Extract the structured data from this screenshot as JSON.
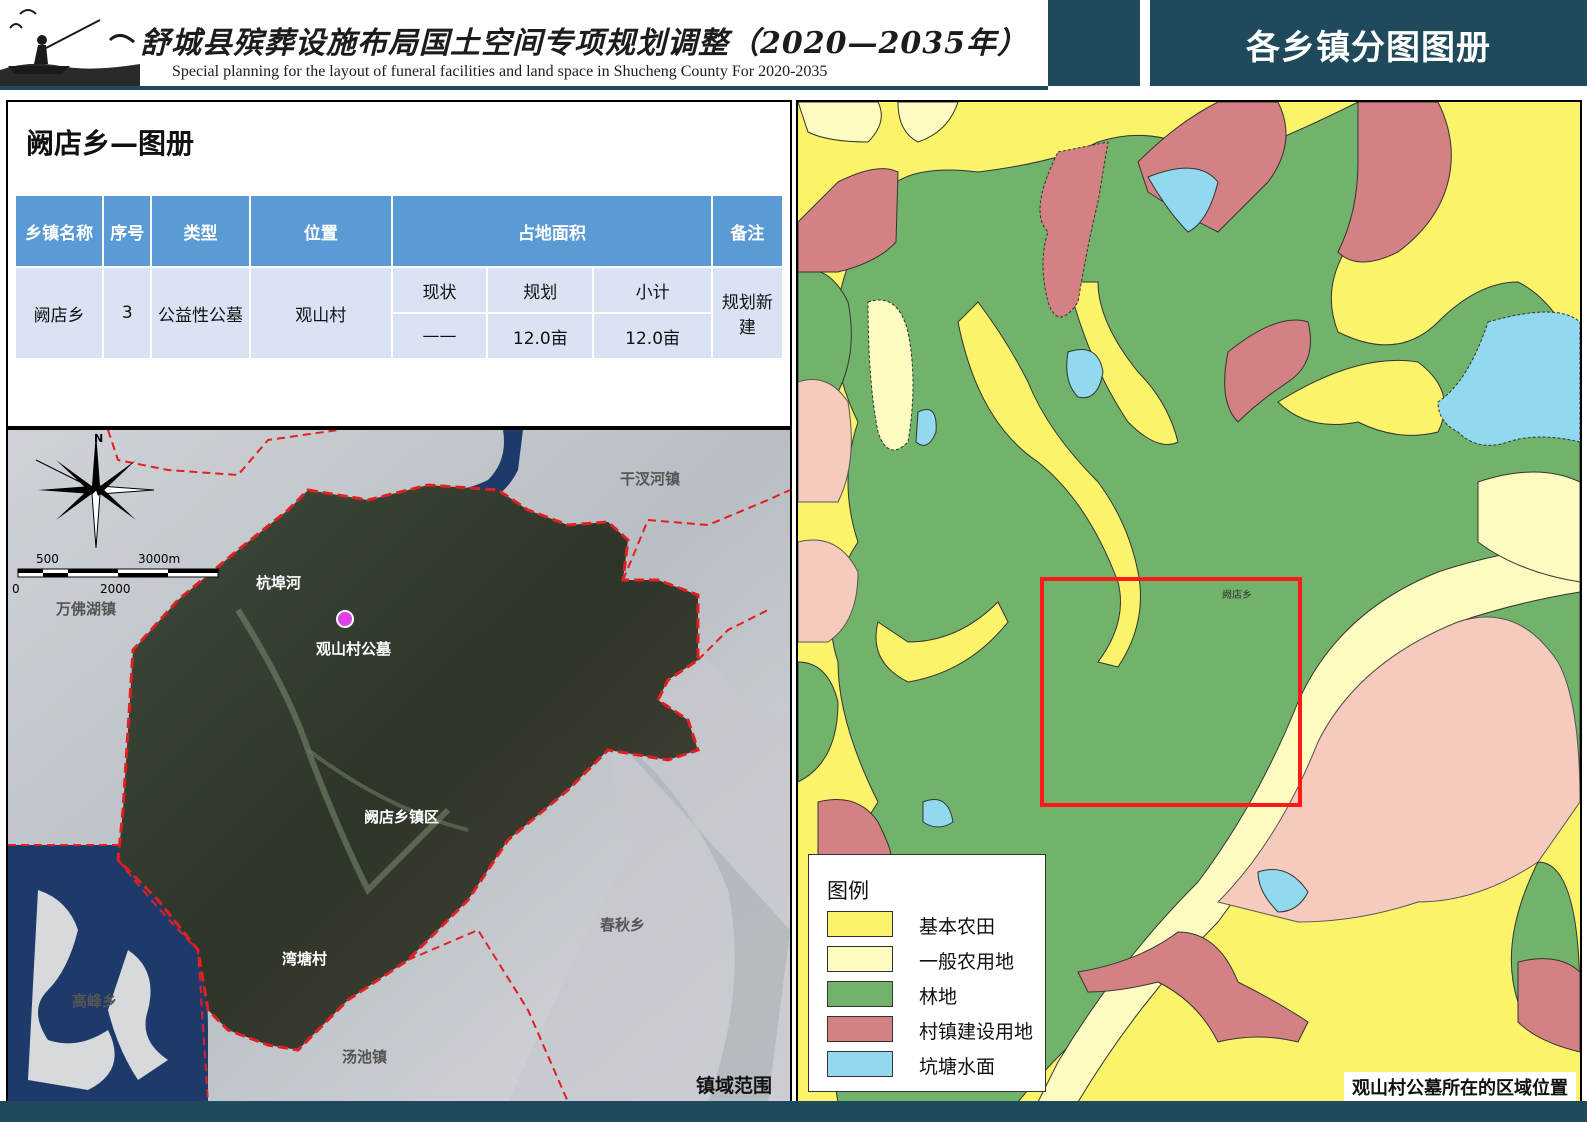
{
  "header": {
    "title_cn": "舒城县殡葬设施布局国土空间专项规划调整（2020—2035年）",
    "title_en": "Special planning for the layout of funeral facilities and land space in Shucheng County For 2020-2035",
    "section_title": "各乡镇分图图册"
  },
  "info_panel": {
    "title": "阙店乡—图册",
    "columns": {
      "township": "乡镇名称",
      "seq": "序号",
      "type": "类型",
      "location": "位置",
      "area": "占地面积",
      "note": "备注",
      "area_sub": [
        "现状",
        "规划",
        "小计"
      ]
    },
    "row": {
      "township": "阙店乡",
      "seq": "3",
      "type": "公益性公墓",
      "location": "观山村",
      "current": "——",
      "planned": "12.0亩",
      "subtotal": "12.0亩",
      "note": "规划新建"
    }
  },
  "left_map": {
    "caption": "镇域范围",
    "north_label": "N",
    "scale_labels": [
      "500",
      "3000m",
      "0",
      "2000"
    ],
    "place_labels": {
      "qianhanhe": "干汊河镇",
      "hangbuhe": "杭埠河",
      "wanfohu": "万佛湖镇",
      "cemetery": "观山村公墓",
      "quedian_town": "阙店乡镇区",
      "chunqiu": "春秋乡",
      "wantang": "湾塘村",
      "gaofeng": "高峰乡",
      "tangchi": "汤池镇"
    },
    "colors": {
      "boundary": "#e02020",
      "marker": "#e040e8",
      "water": "#1d3a6b"
    }
  },
  "right_map": {
    "caption": "观山村公墓所在的区域位置",
    "area_label": "阙店乡",
    "legend": {
      "title": "图例",
      "items": [
        {
          "label": "基本农田",
          "color": "#fbf46a"
        },
        {
          "label": "一般农用地",
          "color": "#fdfbbf"
        },
        {
          "label": "林地",
          "color": "#72b36b"
        },
        {
          "label": "村镇建设用地",
          "color": "#d48184"
        },
        {
          "label": "坑塘水面",
          "color": "#92d8ef"
        }
      ]
    },
    "colors": {
      "forest": "#72b36b",
      "basic_farm": "#fbf46a",
      "general_farm": "#fdfbbf",
      "construction": "#d48184",
      "pond": "#92d8ef",
      "pink": "#f6cbbd",
      "highlight": "#ff1a1a"
    }
  }
}
